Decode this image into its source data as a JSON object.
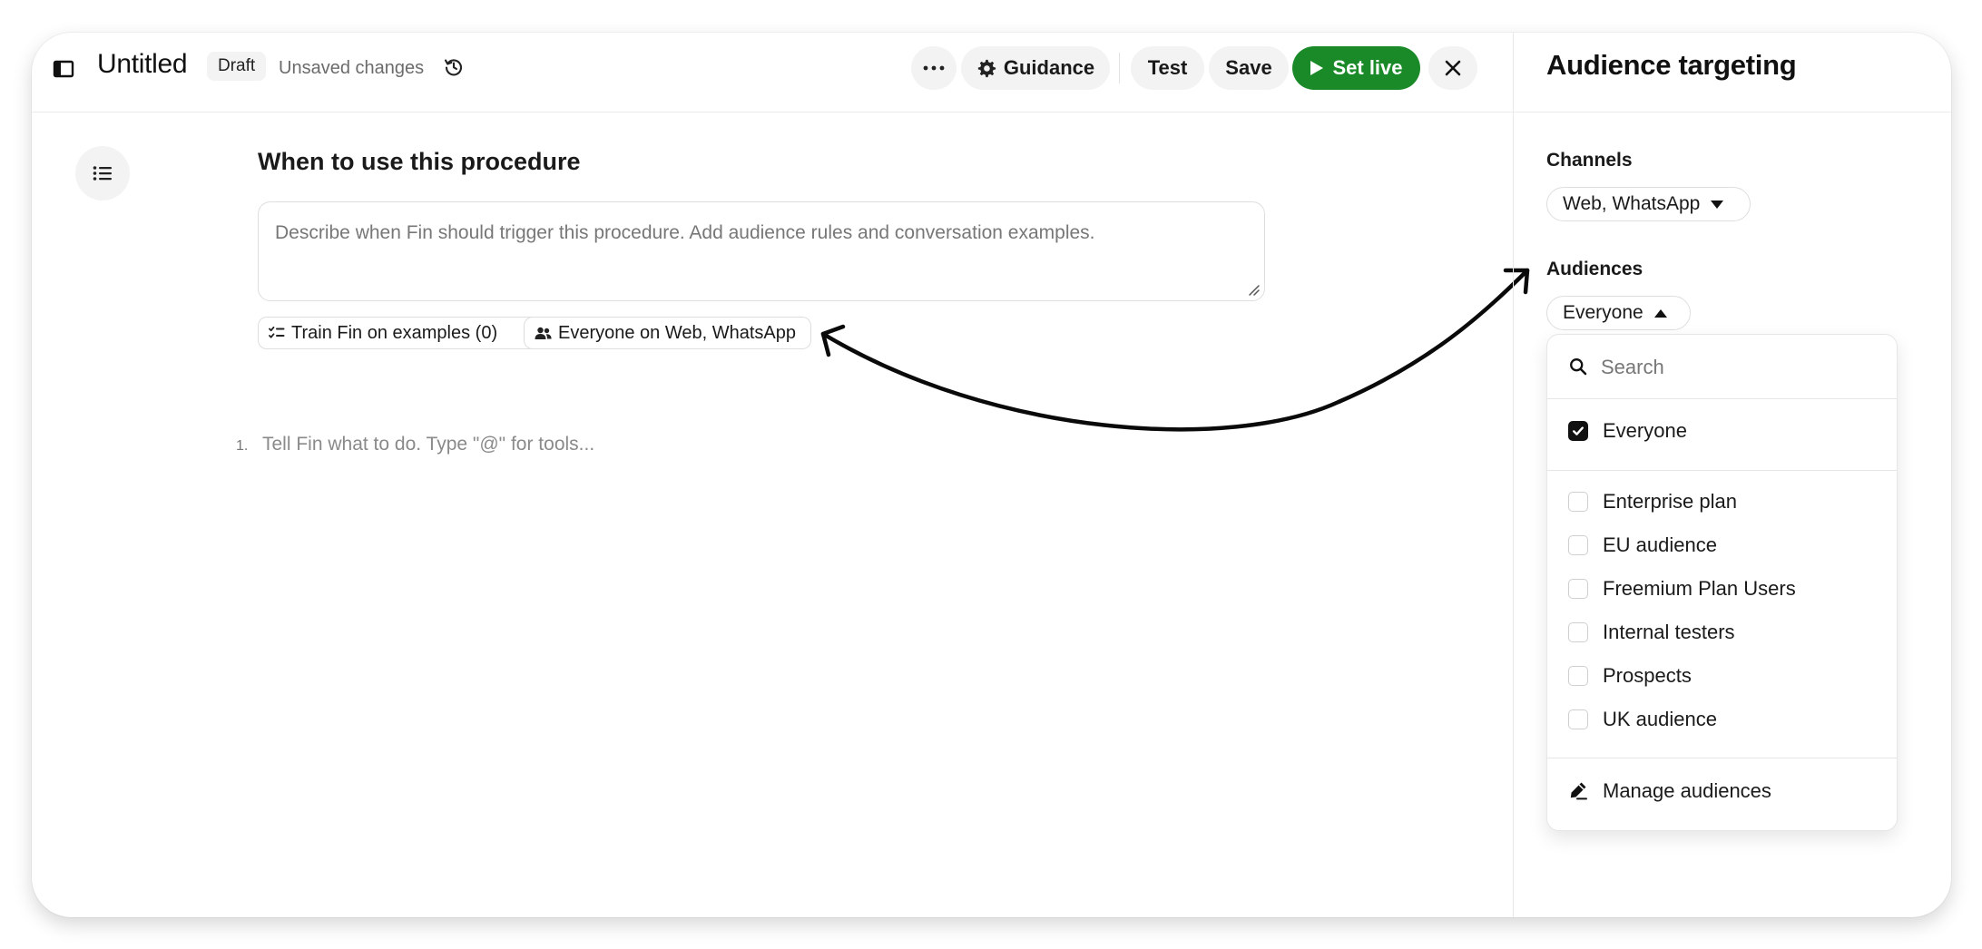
{
  "header": {
    "title": "Untitled",
    "status_badge": "Draft",
    "unsaved_text": "Unsaved changes",
    "buttons": {
      "guidance": "Guidance",
      "test": "Test",
      "save": "Save",
      "set_live": "Set live"
    },
    "accent_color": "#1a8a28"
  },
  "editor": {
    "section_title": "When to use this procedure",
    "describe_placeholder": "Describe when Fin should trigger this procedure. Add audience rules and conversation examples.",
    "chips": {
      "train": "Train Fin on examples (0)",
      "audience": "Everyone on Web, WhatsApp"
    },
    "steps": [
      {
        "number": "1.",
        "placeholder": "Tell Fin what to do. Type \"@\" for tools..."
      }
    ]
  },
  "panel": {
    "title": "Audience targeting",
    "channels_label": "Channels",
    "channels_value": "Web, WhatsApp",
    "audiences_label": "Audiences",
    "audiences_value": "Everyone",
    "dropdown": {
      "search_placeholder": "Search",
      "everyone": {
        "label": "Everyone",
        "checked": true
      },
      "options": [
        {
          "label": "Enterprise plan",
          "checked": false
        },
        {
          "label": "EU audience",
          "checked": false
        },
        {
          "label": "Freemium Plan Users",
          "checked": false
        },
        {
          "label": "Internal testers",
          "checked": false
        },
        {
          "label": "Prospects",
          "checked": false
        },
        {
          "label": "UK audience",
          "checked": false
        }
      ],
      "manage_label": "Manage audiences"
    }
  },
  "icons": {
    "sidebar_toggle": "sidebar-toggle-icon",
    "history": "history-icon",
    "more": "more-icon",
    "guidance": "gear-icon",
    "set_live": "play-icon",
    "close": "close-icon",
    "outline": "list-icon",
    "train_chip": "checklist-icon",
    "audience_chip": "people-icon",
    "dropdown_caret": "caret-icon",
    "search": "search-icon",
    "checkbox": "check-icon",
    "manage": "pencil-icon"
  }
}
